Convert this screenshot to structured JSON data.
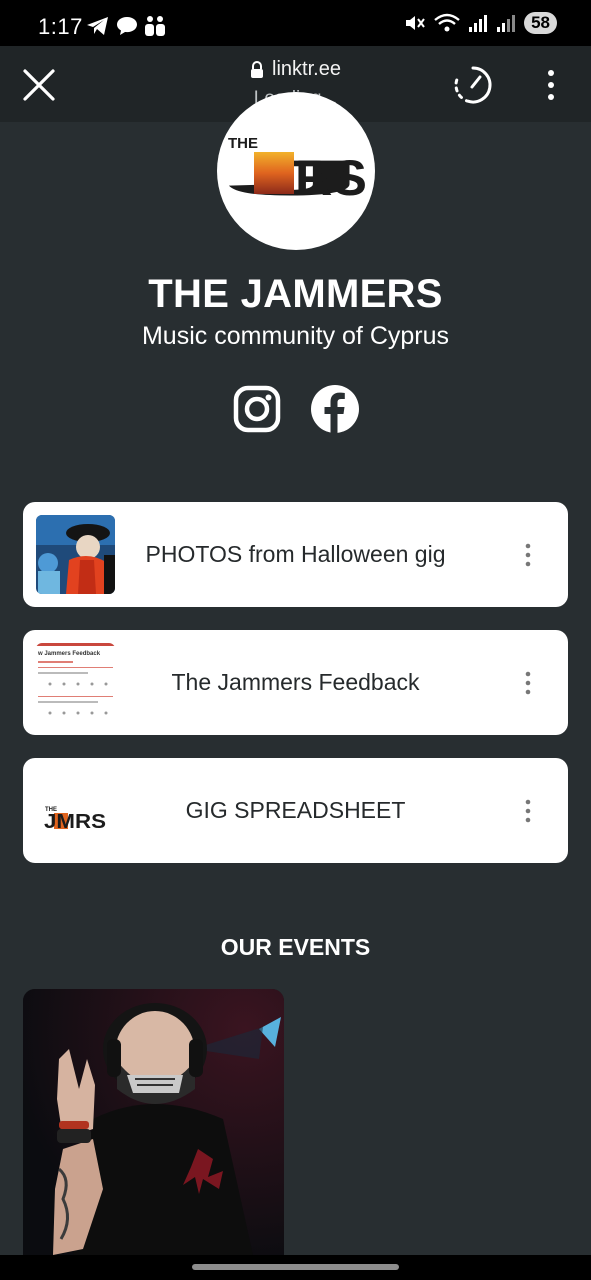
{
  "status_bar": {
    "time": "1:17",
    "battery": "58",
    "icons_left": [
      "telegram-icon",
      "chat-bubble-icon",
      "teams-icon"
    ],
    "icons_right": [
      "mute-icon",
      "wifi-icon",
      "signal-icon",
      "signal-roaming-icon"
    ]
  },
  "browser": {
    "url": "linktr.ee",
    "status": "Loading..."
  },
  "profile": {
    "logo_top": "THE",
    "logo_main": "JMRS",
    "name": "THE JAMMERS",
    "description": "Music community of Cyprus",
    "social": [
      "instagram-icon",
      "facebook-icon"
    ]
  },
  "links": [
    {
      "label": "PHOTOS from Halloween gig"
    },
    {
      "label": "The Jammers Feedback",
      "thumb_title": "w Jammers Feedback"
    },
    {
      "label": "GIG SPREADSHEET",
      "logo_top": "THE",
      "logo_main": "JMRS"
    }
  ],
  "events": {
    "title": "OUR EVENTS"
  },
  "colors": {
    "background": "#282e31",
    "card": "#ffffff",
    "toolbar": "#202527"
  }
}
